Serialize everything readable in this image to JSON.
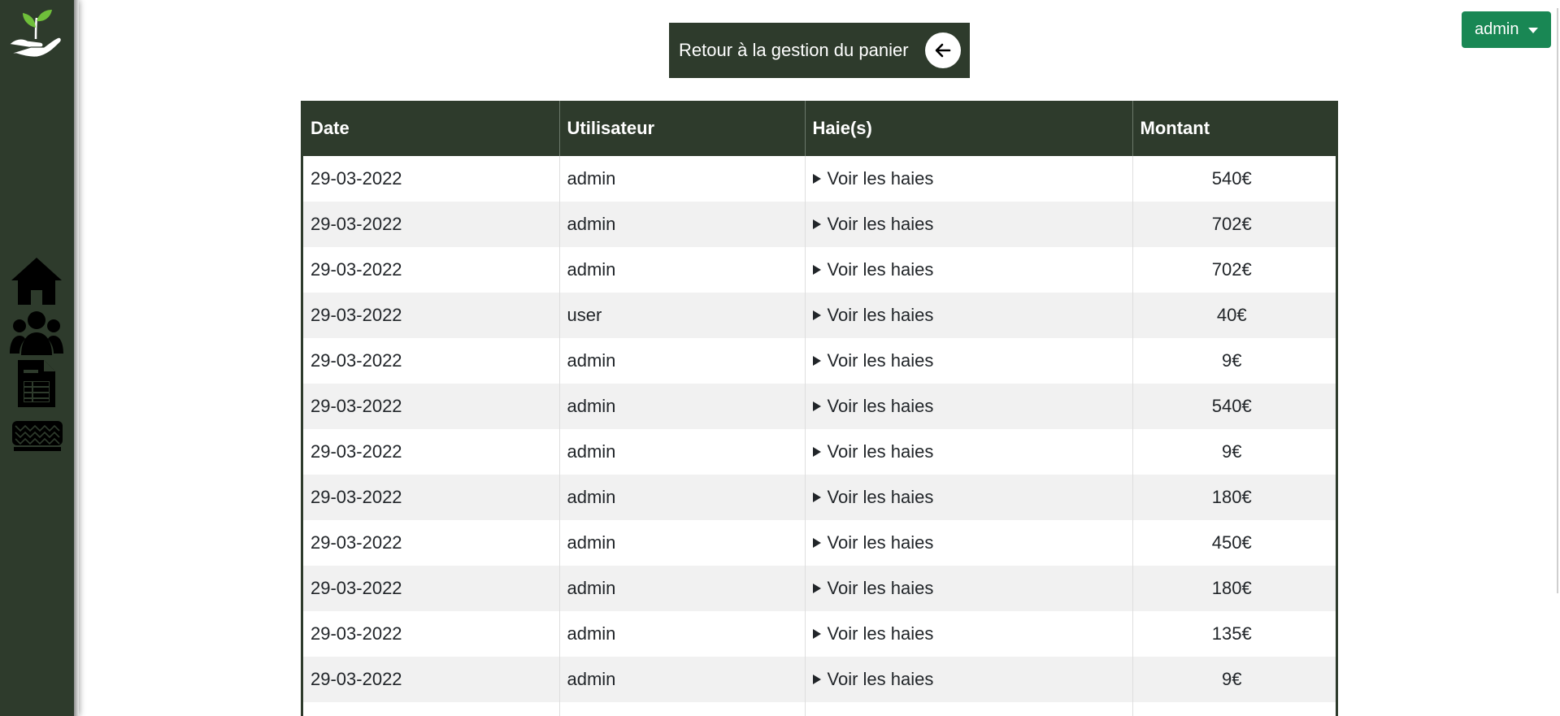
{
  "sidebar": {
    "icons": [
      "plant-hand-logo-icon",
      "home-icon",
      "users-icon",
      "spreadsheet-icon",
      "hedge-icon"
    ]
  },
  "header": {
    "user_menu_label": "admin",
    "back_button_label": "Retour à la gestion du panier"
  },
  "table": {
    "columns": [
      "Date",
      "Utilisateur",
      "Haie(s)",
      "Montant"
    ],
    "rows": [
      {
        "date": "29-03-2022",
        "user": "admin",
        "hedges": "Voir les haies",
        "amount": "540€"
      },
      {
        "date": "29-03-2022",
        "user": "admin",
        "hedges": "Voir les haies",
        "amount": "702€"
      },
      {
        "date": "29-03-2022",
        "user": "admin",
        "hedges": "Voir les haies",
        "amount": "702€"
      },
      {
        "date": "29-03-2022",
        "user": "user",
        "hedges": "Voir les haies",
        "amount": "40€"
      },
      {
        "date": "29-03-2022",
        "user": "admin",
        "hedges": "Voir les haies",
        "amount": "9€"
      },
      {
        "date": "29-03-2022",
        "user": "admin",
        "hedges": "Voir les haies",
        "amount": "540€"
      },
      {
        "date": "29-03-2022",
        "user": "admin",
        "hedges": "Voir les haies",
        "amount": "9€"
      },
      {
        "date": "29-03-2022",
        "user": "admin",
        "hedges": "Voir les haies",
        "amount": "180€"
      },
      {
        "date": "29-03-2022",
        "user": "admin",
        "hedges": "Voir les haies",
        "amount": "450€"
      },
      {
        "date": "29-03-2022",
        "user": "admin",
        "hedges": "Voir les haies",
        "amount": "180€"
      },
      {
        "date": "29-03-2022",
        "user": "admin",
        "hedges": "Voir les haies",
        "amount": "135€"
      },
      {
        "date": "29-03-2022",
        "user": "admin",
        "hedges": "Voir les haies",
        "amount": "9€"
      },
      {
        "date": "",
        "user": "",
        "hedges": "",
        "amount": ""
      }
    ]
  },
  "colors": {
    "sidebar_bg": "#2e3b2c",
    "header_bg": "#2e3b2c",
    "accent_green": "#198754"
  }
}
